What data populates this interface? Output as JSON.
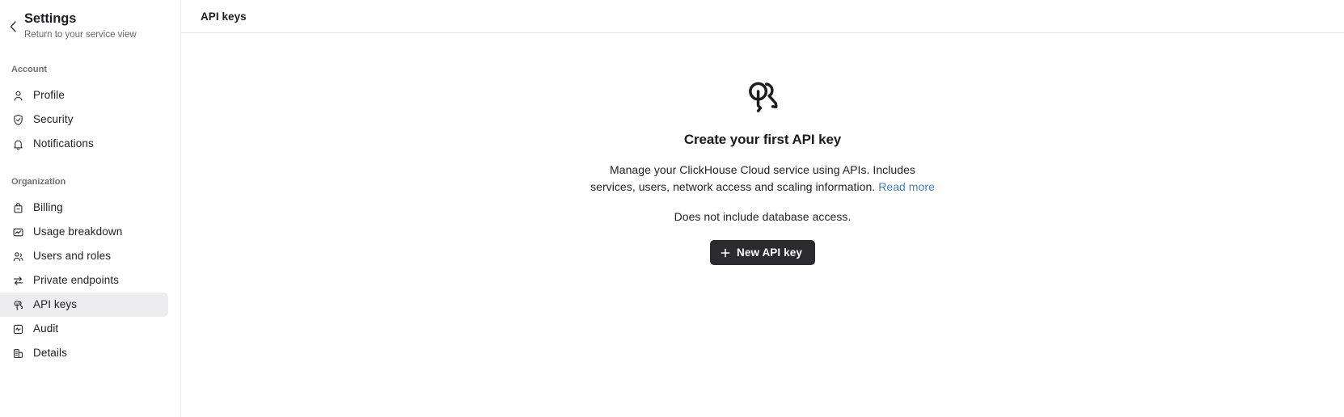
{
  "sidebar": {
    "back_icon": "chevron-left-icon",
    "title": "Settings",
    "subtitle": "Return to your service view",
    "groups": [
      {
        "label": "Account",
        "items": [
          {
            "label": "Profile",
            "icon": "user-icon",
            "selected": false
          },
          {
            "label": "Security",
            "icon": "shield-check-icon",
            "selected": false
          },
          {
            "label": "Notifications",
            "icon": "bell-icon",
            "selected": false
          }
        ]
      },
      {
        "label": "Organization",
        "items": [
          {
            "label": "Billing",
            "icon": "billing-icon",
            "selected": false
          },
          {
            "label": "Usage breakdown",
            "icon": "usage-chart-icon",
            "selected": false
          },
          {
            "label": "Users and roles",
            "icon": "users-icon",
            "selected": false
          },
          {
            "label": "Private endpoints",
            "icon": "transfer-arrows-icon",
            "selected": false
          },
          {
            "label": "API keys",
            "icon": "keys-icon",
            "selected": true
          },
          {
            "label": "Audit",
            "icon": "audit-log-icon",
            "selected": false
          },
          {
            "label": "Details",
            "icon": "building-icon",
            "selected": false
          }
        ]
      }
    ]
  },
  "header": {
    "title": "API keys"
  },
  "empty_state": {
    "icon": "keys-icon",
    "title": "Create your first API key",
    "description": "Manage your ClickHouse Cloud service using APIs. Includes services, users, network access and scaling information.",
    "read_more_label": "Read more",
    "note": "Does not include database access.",
    "button": {
      "icon": "plus-icon",
      "label": "New API key"
    }
  },
  "colors": {
    "accent_link": "#3b7fe0",
    "button_bg": "#2b2b2f",
    "selected_item_bg": "#ededef",
    "border": "#e8e8ea"
  }
}
